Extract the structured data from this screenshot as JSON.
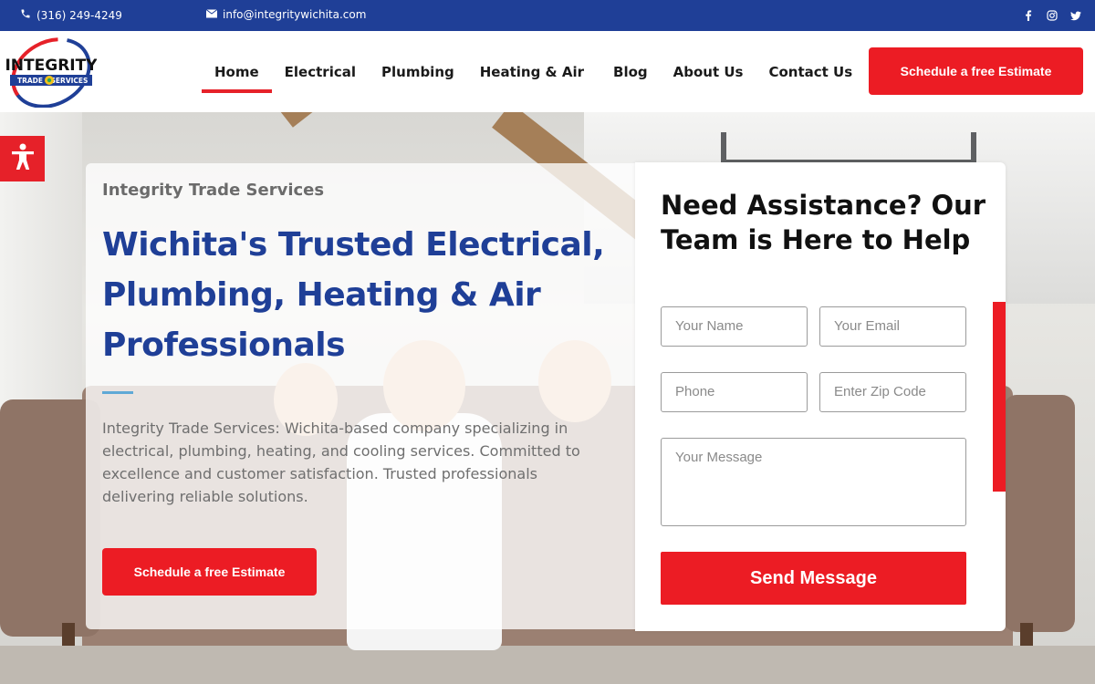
{
  "topbar": {
    "phone": "(316) 249-4249",
    "email": "info@integritywichita.com",
    "social": [
      "facebook-icon",
      "instagram-icon",
      "twitter-icon"
    ]
  },
  "logo": {
    "line1": "INTEGRITY",
    "line2": "TRADE",
    "line3": "SERVICES"
  },
  "nav": {
    "items": [
      {
        "label": "Home",
        "active": true
      },
      {
        "label": "Electrical"
      },
      {
        "label": "Plumbing"
      },
      {
        "label": "Heating & Air"
      },
      {
        "label": "Blog"
      },
      {
        "label": "About Us"
      },
      {
        "label": "Contact Us"
      }
    ],
    "cta_label": "Schedule a free Estimate"
  },
  "hero": {
    "eyebrow": "Integrity Trade Services",
    "headline": "Wichita's Trusted Electrical, Plumbing, Heating & Air Professionals",
    "description": "Integrity Trade Services: Wichita-based company specializing in electrical, plumbing, heating, and cooling services. Committed to excellence and customer satisfaction. Trusted professionals delivering reliable solutions.",
    "cta_label": "Schedule a free Estimate"
  },
  "form": {
    "title": "Need Assistance? Our Team is Here to Help",
    "name_placeholder": "Your Name",
    "email_placeholder": "Your Email",
    "phone_placeholder": "Phone",
    "zip_placeholder": "Enter Zip Code",
    "message_placeholder": "Your Message",
    "submit_label": "Send Message"
  },
  "colors": {
    "topbar_bg": "#1f3f97",
    "brand_blue": "#1f3f97",
    "accent_red": "#ec1c24"
  }
}
